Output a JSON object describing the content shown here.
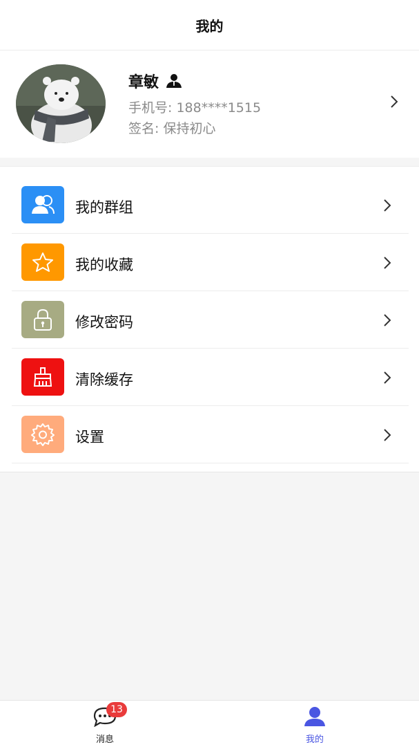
{
  "header": {
    "title": "我的"
  },
  "profile": {
    "name": "章敏",
    "phone": "手机号: 188****1515",
    "signature": "签名: 保持初心"
  },
  "menu": {
    "items": [
      {
        "label": "我的群组",
        "icon": "group-icon",
        "color": "#2b8ff5"
      },
      {
        "label": "我的收藏",
        "icon": "star-icon",
        "color": "#ff9800"
      },
      {
        "label": "修改密码",
        "icon": "lock-icon",
        "color": "#a7ab83"
      },
      {
        "label": "清除缓存",
        "icon": "broom-icon",
        "color": "#ee1111"
      },
      {
        "label": "设置",
        "icon": "gear-icon",
        "color": "#ffab7c"
      }
    ]
  },
  "tabbar": {
    "tabs": [
      {
        "label": "消息",
        "icon": "chat-icon",
        "badge": "13",
        "active": false
      },
      {
        "label": "我的",
        "icon": "person-icon",
        "active": true
      }
    ],
    "active_color": "#4a56e2"
  }
}
